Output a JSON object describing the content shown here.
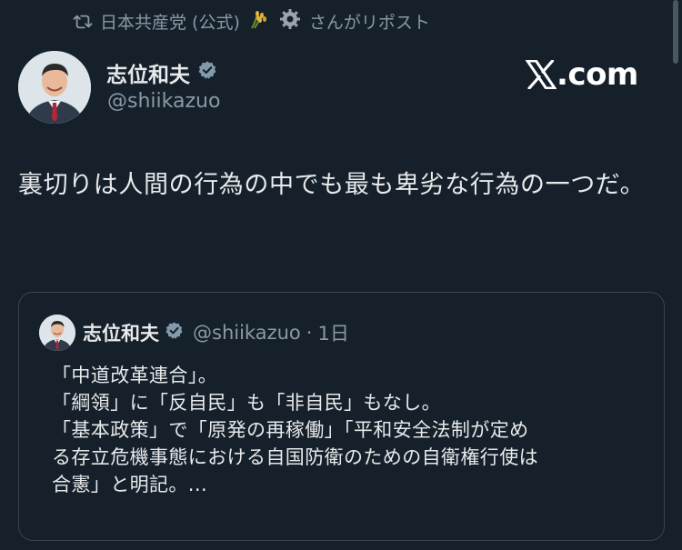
{
  "repost": {
    "icon": "repost-icon",
    "name": "日本共産党 (公式)",
    "emojis": [
      "rice-ear-emoji",
      "gear-emoji"
    ],
    "suffix": "さんがリポスト"
  },
  "author": {
    "name": "志位和夫",
    "handle": "@shiikazuo",
    "verified_icon": "verified-badge-icon"
  },
  "brand": {
    "icon": "x-logo-icon",
    "label": ".com"
  },
  "tweet": {
    "text": "裏切りは人間の行為の中でも最も卑劣な行為の一つだ。"
  },
  "quote": {
    "name": "志位和夫",
    "verified_icon": "verified-badge-icon",
    "handle": "@shiikazuo",
    "separator": "·",
    "time": "1日",
    "lines": [
      "「中道改革連合」。",
      "「綱領」に「反自民」も「非自民」もなし。",
      "「基本政策」で「原発の再稼働」「平和安全法制が定め",
      "る存立危機事態における自国防衛のための自衛権行使は",
      "合憲」と明記。..."
    ]
  },
  "colors": {
    "background": "#15202b",
    "text_primary": "#e7e9ea",
    "text_secondary": "#8b98a5",
    "border": "#38444d",
    "verified": "#829aab"
  }
}
